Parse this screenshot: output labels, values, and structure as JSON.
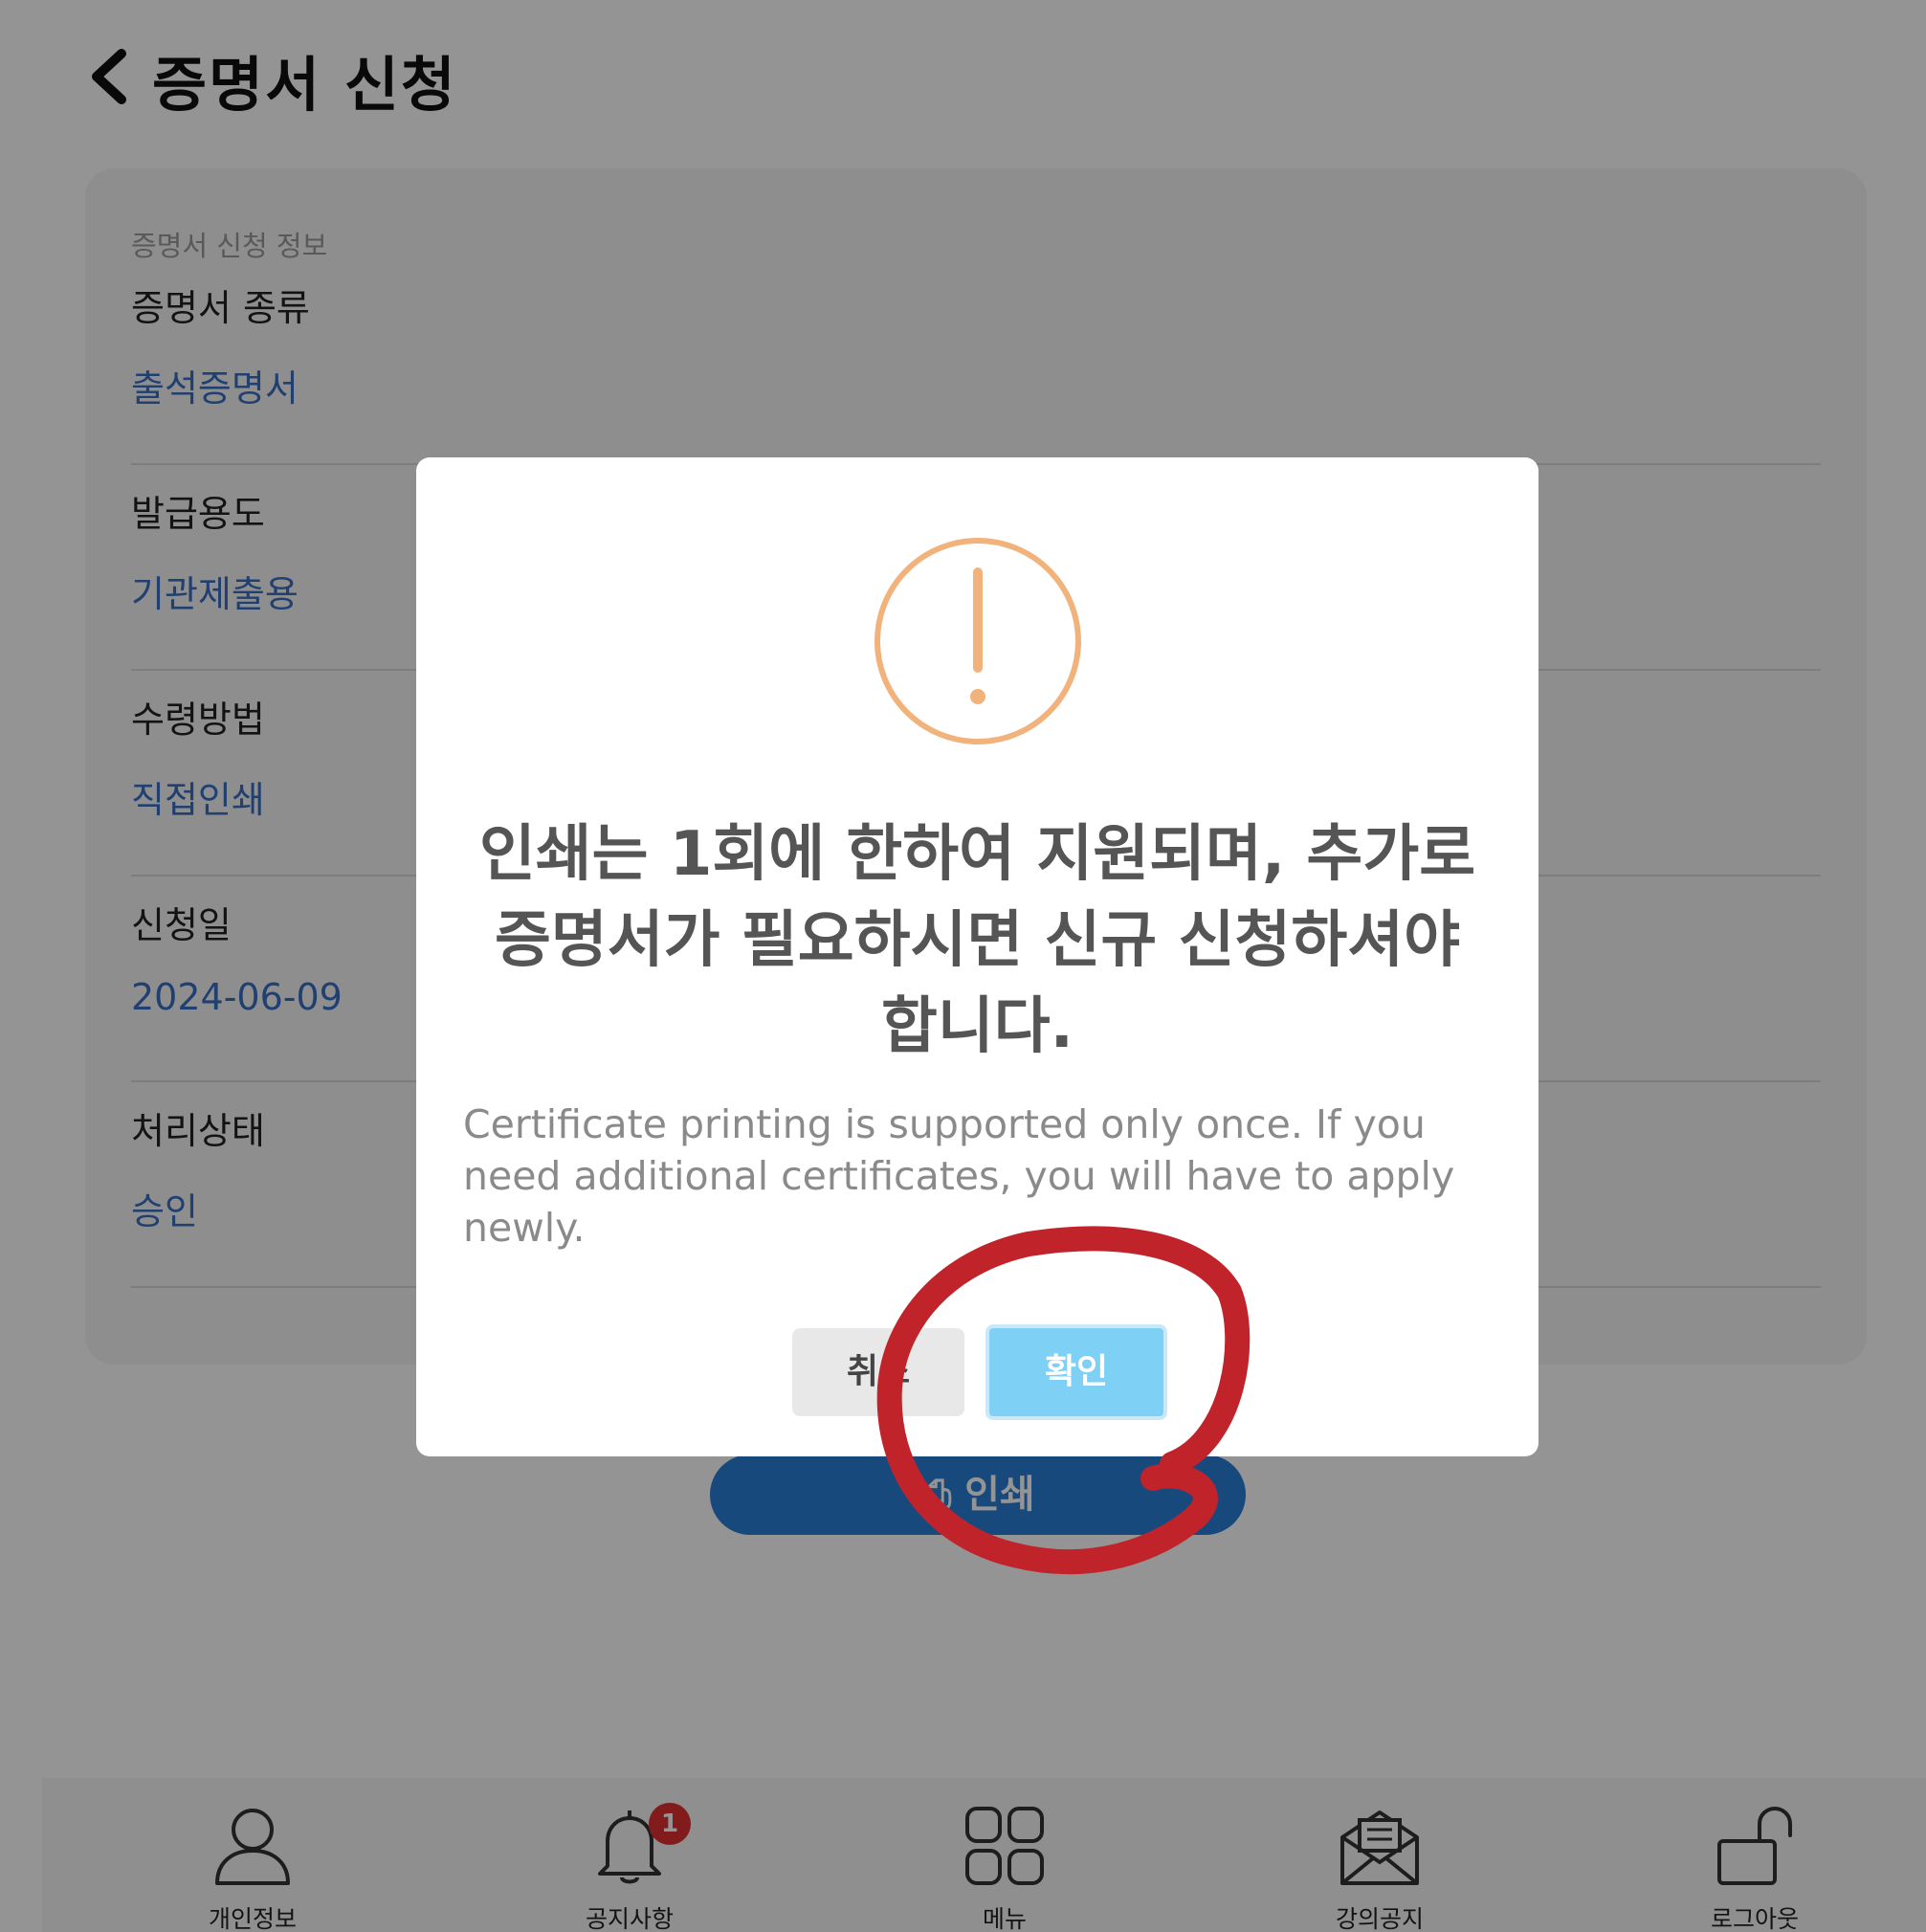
{
  "header": {
    "title": "증명서 신청"
  },
  "card": {
    "section_title": "증명서 신청 정보",
    "fields": [
      {
        "label": "증명서 종류",
        "value": "출석증명서"
      },
      {
        "label": "발급용도",
        "value": "기관제출용"
      },
      {
        "label": "수령방법",
        "value": "직접인쇄"
      },
      {
        "label": "신청일",
        "value": "2024-06-09"
      },
      {
        "label": "처리상태",
        "value": "승인"
      }
    ]
  },
  "print_button": {
    "label": "인쇄"
  },
  "modal": {
    "title_line1": "인쇄는 1회에 한하여 지원되며, 추가로",
    "title_line2": "증명서가 필요하시면 신규 신청하셔야",
    "title_line3": "합니다.",
    "subtitle": "Certificate printing is supported only once. If you need additional certificates, you will have to apply newly.",
    "cancel_label": "취소",
    "confirm_label": "확인"
  },
  "bottom_nav": {
    "items": [
      {
        "label": "개인정보",
        "icon": "person-icon"
      },
      {
        "label": "공지사항",
        "icon": "bell-icon",
        "badge": "1"
      },
      {
        "label": "메뉴",
        "icon": "grid-icon"
      },
      {
        "label": "강의공지",
        "icon": "envelope-icon"
      },
      {
        "label": "로그아웃",
        "icon": "unlock-icon"
      }
    ]
  },
  "colors": {
    "accent_link": "#3a6fc4",
    "warning": "#f2b27c",
    "confirm": "#7fd0f5",
    "badge": "#e03131",
    "annotation": "#c0242a"
  }
}
